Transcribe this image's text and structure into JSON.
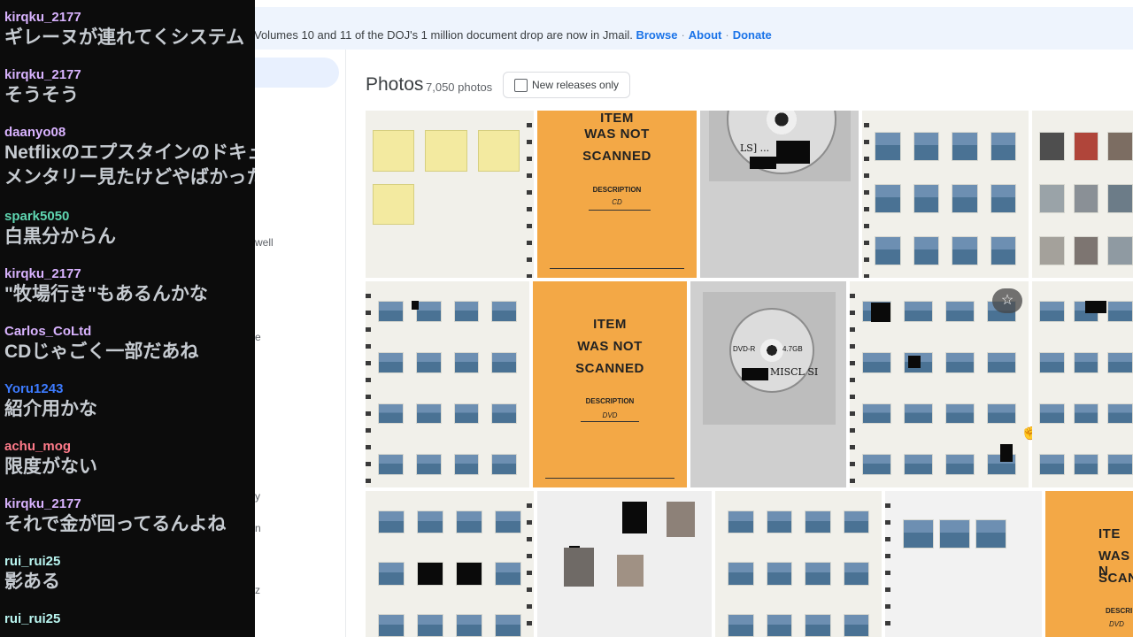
{
  "colors": {
    "accent_link": "#1a73e8",
    "chat_background": "#0c0c0c",
    "chat_text": "#c6cbd1",
    "card_orange": "#f3a846"
  },
  "banner": {
    "text": "Volumes 10 and 11 of the DOJ's 1 million document drop are now in Jmail.",
    "links": [
      "Browse",
      "About",
      "Donate"
    ]
  },
  "nav_fragments": [
    "well",
    "e",
    "y",
    "n",
    "z"
  ],
  "photos": {
    "title": "Photos",
    "count": "7,050 photos",
    "filter_label": "New releases only"
  },
  "cards": {
    "not_scanned": {
      "line1": "ITEM",
      "line2": "WAS NOT",
      "line3": "SCANNED",
      "description": "DESCRIPTION",
      "handwriting_1": "CD",
      "handwriting_2": "DVD"
    },
    "disc_labels": {
      "cd": "LS] ...",
      "dvd_r": "DVD-R",
      "capacity": "4.7GB",
      "handwritten": "MISCL SI"
    },
    "partial_card": {
      "line1": "ITE",
      "line2": "WAS N",
      "line3": "SCAN",
      "description": "DESCRI",
      "handwriting": "DVD"
    }
  },
  "icons": {
    "star": "☆",
    "cursor": "pointer-hand"
  },
  "chat": {
    "messages": [
      {
        "user": "kirqku_2177",
        "color": "#d9b3ff",
        "text": "ギレーヌが連れてくシステム"
      },
      {
        "user": "kirqku_2177",
        "color": "#d9b3ff",
        "text": "そうそう"
      },
      {
        "user": "daanyo08",
        "color": "#d9b3ff",
        "text": "Netflixのエプスタインのドキュ"
      },
      {
        "user": "",
        "color": "#d9b3ff",
        "text": "メンタリー見たけどやばかった"
      },
      {
        "user": "spark5050",
        "color": "#5fd6b1",
        "text": "白黒分からん"
      },
      {
        "user": "kirqku_2177",
        "color": "#d9b3ff",
        "text": "\"牧場行き\"もあるんかな"
      },
      {
        "user": "Carlos_CoLtd",
        "color": "#d9b3ff",
        "text": "CDじゃごく一部だあね"
      },
      {
        "user": "Yoru1243",
        "color": "#3d7bff",
        "text": "紹介用かな"
      },
      {
        "user": "achu_mog",
        "color": "#ff7b8a",
        "text": "限度がない"
      },
      {
        "user": "kirqku_2177",
        "color": "#d9b3ff",
        "text": "それで金が回ってるんよね"
      },
      {
        "user": "rui_rui25",
        "color": "#b9f5f0",
        "text": "影ある"
      },
      {
        "user": "rui_rui25",
        "color": "#b9f5f0",
        "text": ""
      }
    ]
  }
}
